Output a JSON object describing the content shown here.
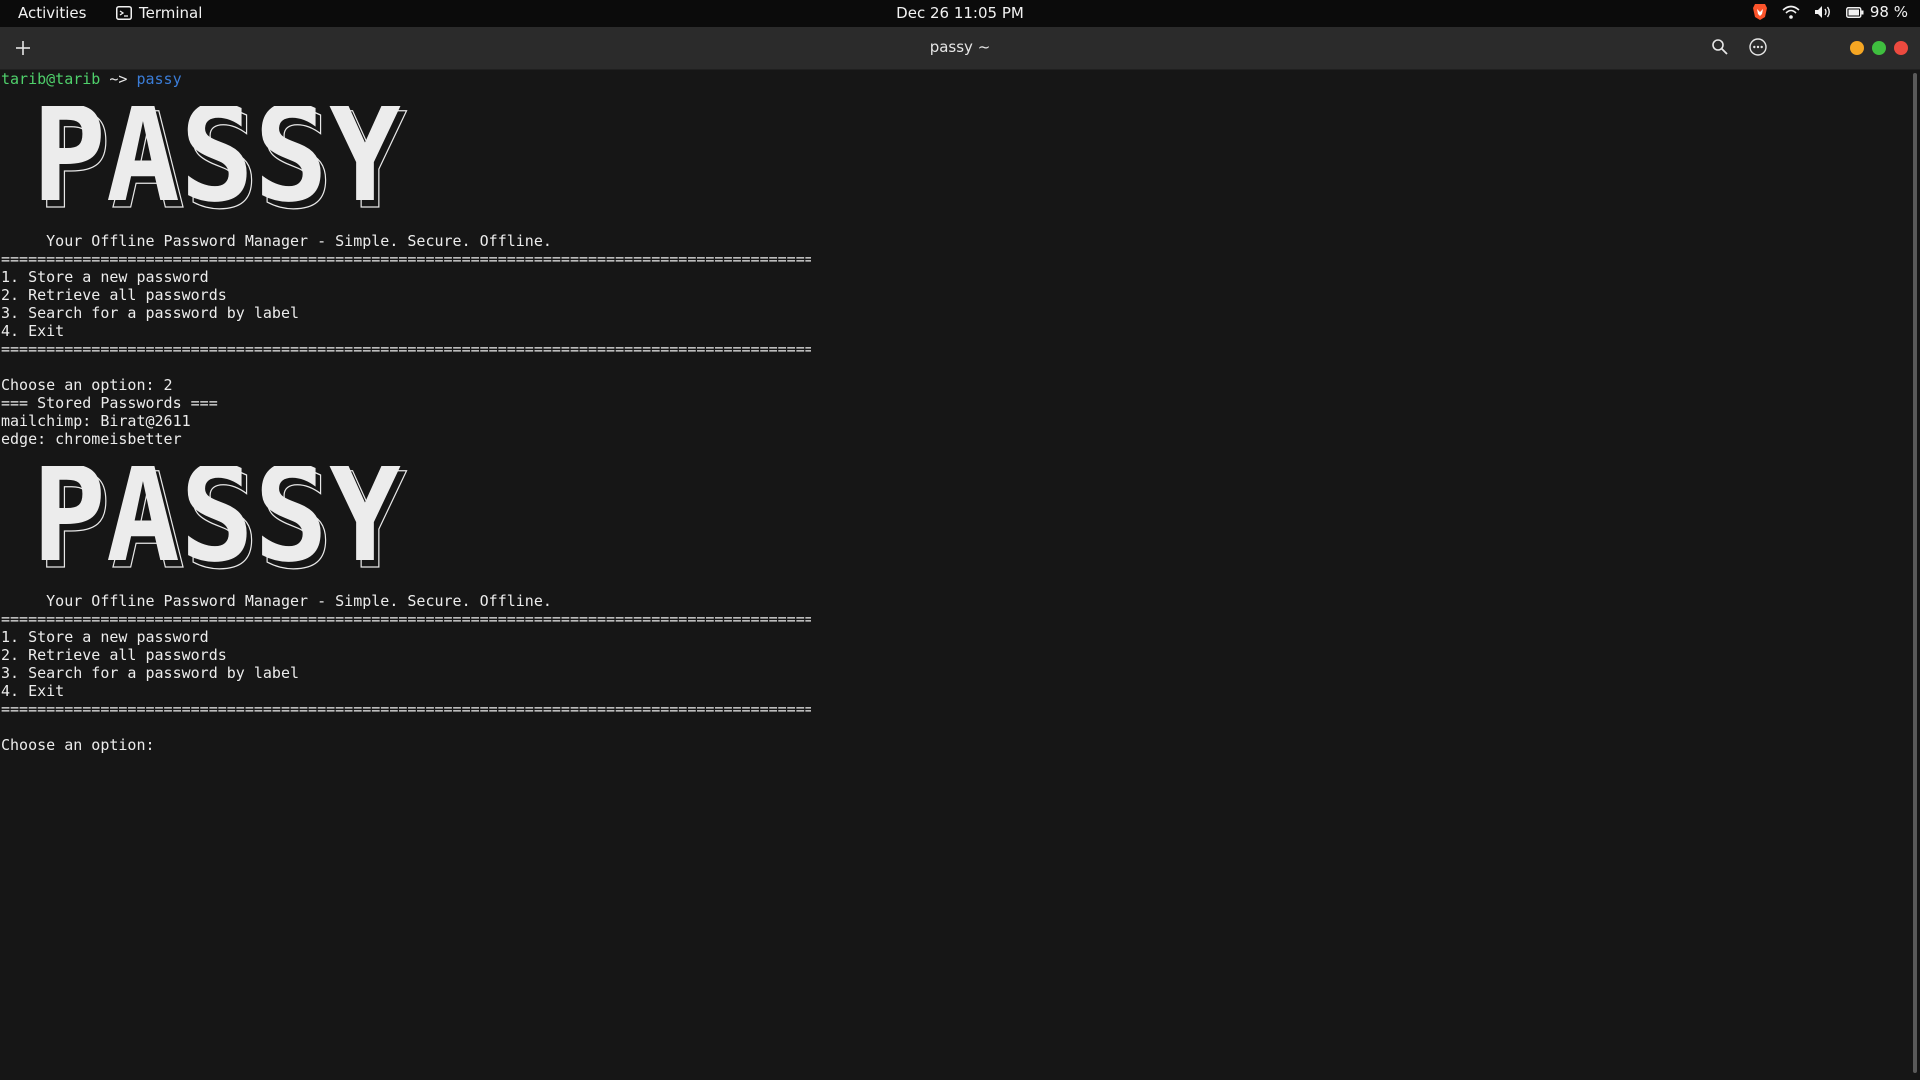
{
  "topbar": {
    "activities": "Activities",
    "app_name": "Terminal",
    "clock": "Dec 26  11:05 PM",
    "battery": "98 %",
    "icons": [
      "brave-icon",
      "wifi-icon",
      "volume-icon",
      "battery-icon"
    ]
  },
  "window": {
    "title": "passy ~",
    "controls": {
      "minimize_color": "#f5a623",
      "maximize_color": "#3fbf3f",
      "close_color": "#ec4a3f"
    }
  },
  "terminal": {
    "prompt": {
      "user": "tarib@tarib",
      "arrow": " ~> ",
      "command": "passy"
    },
    "logo_text": "PASSY",
    "session1": {
      "tagline": "     Your Offline Password Manager - Simple. Secure. Offline.",
      "separator": "==========================================================================================",
      "menu": [
        "1. Store a new password",
        "2. Retrieve all passwords",
        "3. Search for a password by label",
        "4. Exit"
      ],
      "choose": "Choose an option: 2",
      "stored_header": "=== Stored Passwords ===",
      "entries": [
        "mailchimp: Birat@2611",
        "edge: chromeisbetter"
      ]
    },
    "session2": {
      "tagline": "     Your Offline Password Manager - Simple. Secure. Offline.",
      "separator": "==========================================================================================",
      "menu": [
        "1. Store a new password",
        "2. Retrieve all passwords",
        "3. Search for a password by label",
        "4. Exit"
      ],
      "choose": "Choose an option:"
    },
    "colors": {
      "background": "#161616",
      "text": "#ececec",
      "prompt_user": "#4fd06b",
      "command": "#3b7dd8"
    }
  }
}
